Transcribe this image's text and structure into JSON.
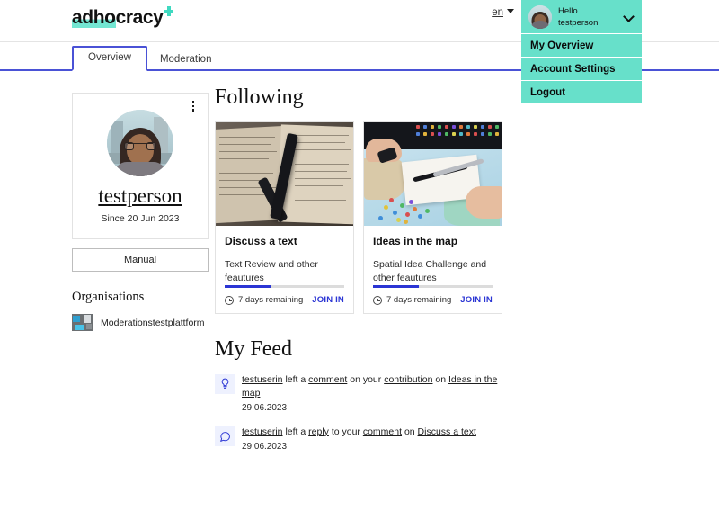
{
  "brand": {
    "name_part1": "adho",
    "name_part2": "cracy",
    "plus_icon": "plus-icon",
    "accent_teal": "#3fd9c0",
    "accent_blue": "#2b35d4"
  },
  "header": {
    "language": {
      "label": "en",
      "caret_icon": "caret-down-icon"
    },
    "user_menu": {
      "greeting": "Hello",
      "username": "testperson",
      "chevron_icon": "chevron-down-icon",
      "avatar_icon": "user-avatar",
      "items": [
        {
          "label": "My Overview"
        },
        {
          "label": "Account Settings"
        },
        {
          "label": "Logout"
        }
      ]
    }
  },
  "tabs": [
    {
      "label": "Overview",
      "active": true
    },
    {
      "label": "Moderation",
      "active": false
    }
  ],
  "sidebar": {
    "profile": {
      "kebab_icon": "more-vertical-icon",
      "avatar_icon": "profile-avatar",
      "name": "testperson",
      "since": "Since 20 Jun 2023"
    },
    "manual_button": "Manual",
    "organisations": {
      "title": "Organisations",
      "items": [
        {
          "name": "Moderationstestplattform",
          "thumb_icon": "organisation-thumbnail"
        }
      ]
    }
  },
  "following": {
    "title": "Following",
    "cards": [
      {
        "image_icon": "book-and-pen-photo",
        "title": "Discuss a text",
        "description": "Text Review and other feautures",
        "progress_percent": 38,
        "time_icon": "clock-icon",
        "time_remaining": "7 days remaining",
        "join_label": "JOIN IN"
      },
      {
        "image_icon": "map-with-pins-photo",
        "title": "Ideas in the map",
        "description": "Spatial Idea Challenge and other feautures",
        "progress_percent": 38,
        "time_icon": "clock-icon",
        "time_remaining": "7 days remaining",
        "join_label": "JOIN IN"
      }
    ]
  },
  "feed": {
    "title": "My Feed",
    "items": [
      {
        "icon": "lightbulb-icon",
        "actor": "testuserin",
        "text_1": " left a ",
        "object_1": "comment",
        "text_2": " on your ",
        "object_2": "contribution",
        "text_3": " on ",
        "target": "Ideas in the map",
        "date": "29.06.2023"
      },
      {
        "icon": "speech-bubble-icon",
        "actor": "testuserin",
        "text_1": " left a ",
        "object_1": "reply",
        "text_2": " to your ",
        "object_2": "comment",
        "text_3": " on ",
        "target": "Discuss a text",
        "date": "29.06.2023"
      }
    ]
  }
}
